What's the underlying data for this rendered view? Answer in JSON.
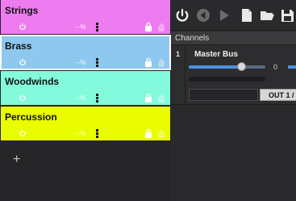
{
  "tracks": [
    {
      "name": "Strings",
      "percent": "--%",
      "color": "#ef7bf0",
      "selected": false
    },
    {
      "name": "Brass",
      "percent": "--%",
      "color": "#8fc8ee",
      "selected": true
    },
    {
      "name": "Woodwinds",
      "percent": "--%",
      "color": "#84fadc",
      "selected": false
    },
    {
      "name": "Percussion",
      "percent": "--%",
      "color": "#eafc00",
      "selected": false
    }
  ],
  "add_label": "+",
  "toolbar": {
    "icons": [
      "power-icon",
      "rewind-icon",
      "play-icon",
      "new-file-icon",
      "open-folder-icon",
      "save-icon"
    ]
  },
  "channels": {
    "header": "Channels",
    "rows": [
      {
        "number": "1",
        "name": "Master Bus",
        "value": "0",
        "output": "OUT 1 /",
        "volume_fraction": 0.68
      }
    ]
  }
}
